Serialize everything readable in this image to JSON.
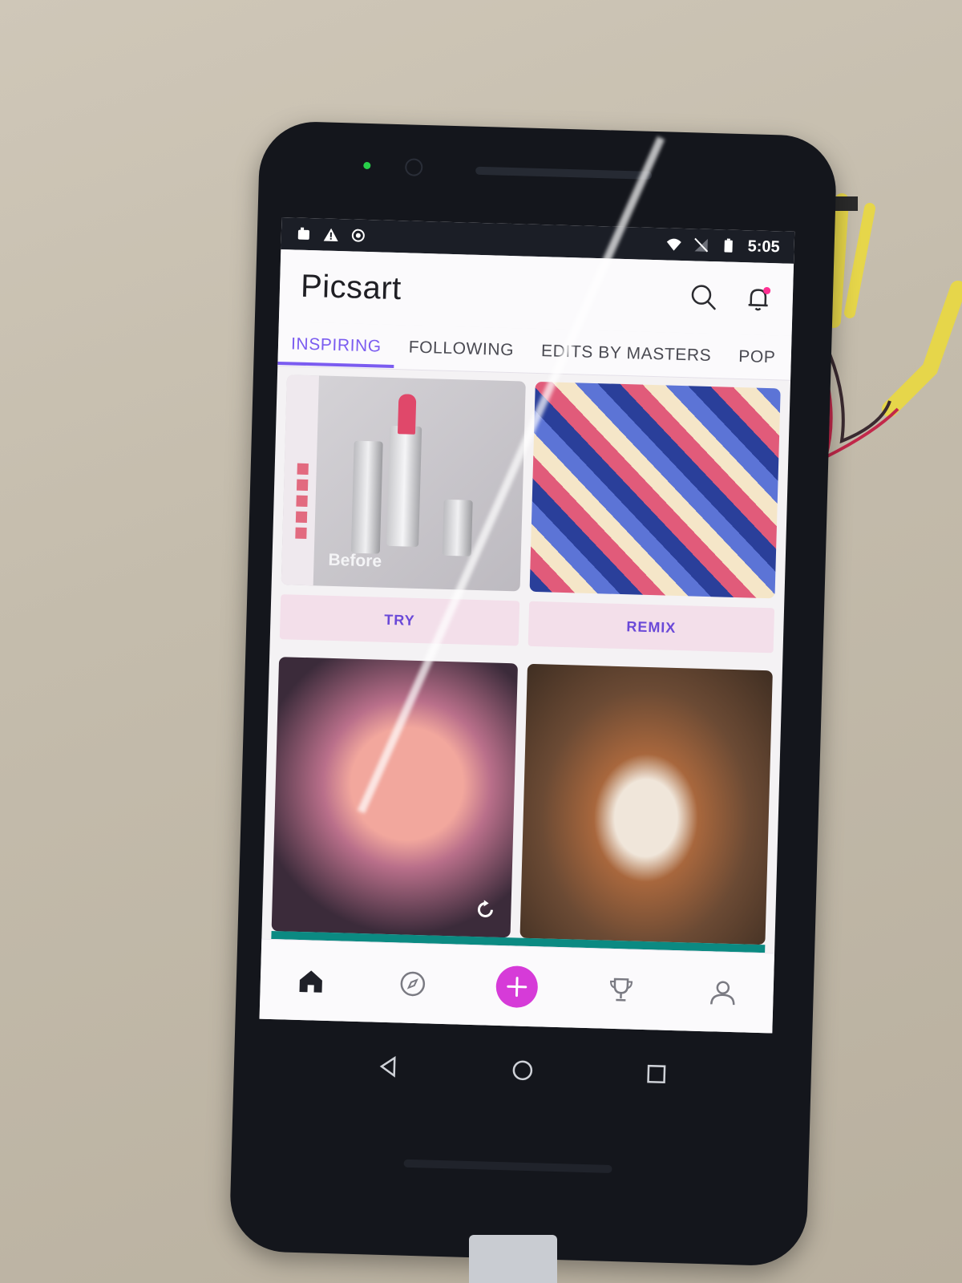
{
  "status_bar": {
    "time": "5:05",
    "left_icons": [
      "notification-icon",
      "warning-icon",
      "record-icon"
    ],
    "right_icons": [
      "wifi-icon",
      "no-sim-icon",
      "battery-icon"
    ]
  },
  "app": {
    "logo": "Picsart",
    "actions": [
      "search-icon",
      "bell-icon"
    ]
  },
  "tabs": [
    {
      "label": "INSPIRING",
      "active": true
    },
    {
      "label": "FOLLOWING",
      "active": false
    },
    {
      "label": "EDITS BY MASTERS",
      "active": false
    },
    {
      "label": "POP",
      "active": false
    }
  ],
  "feed": {
    "cards": [
      {
        "type": "lipstick-editor",
        "overlay": "Before",
        "action": "TRY"
      },
      {
        "type": "collage",
        "action": "REMIX"
      },
      {
        "type": "portrait",
        "action": null
      },
      {
        "type": "portrait-frame",
        "action": null
      }
    ]
  },
  "bottom_nav": [
    "home-icon",
    "explore-icon",
    "create-icon",
    "trophy-icon",
    "profile-icon"
  ],
  "system_nav": [
    "back-icon",
    "home-circle-icon",
    "recents-icon"
  ],
  "colors": {
    "accent": "#7b5cf0",
    "create_button": "#d63bd8",
    "button_bg": "#f3dfea",
    "notification_dot": "#ff2f92",
    "divider_teal": "#0b8a82"
  }
}
